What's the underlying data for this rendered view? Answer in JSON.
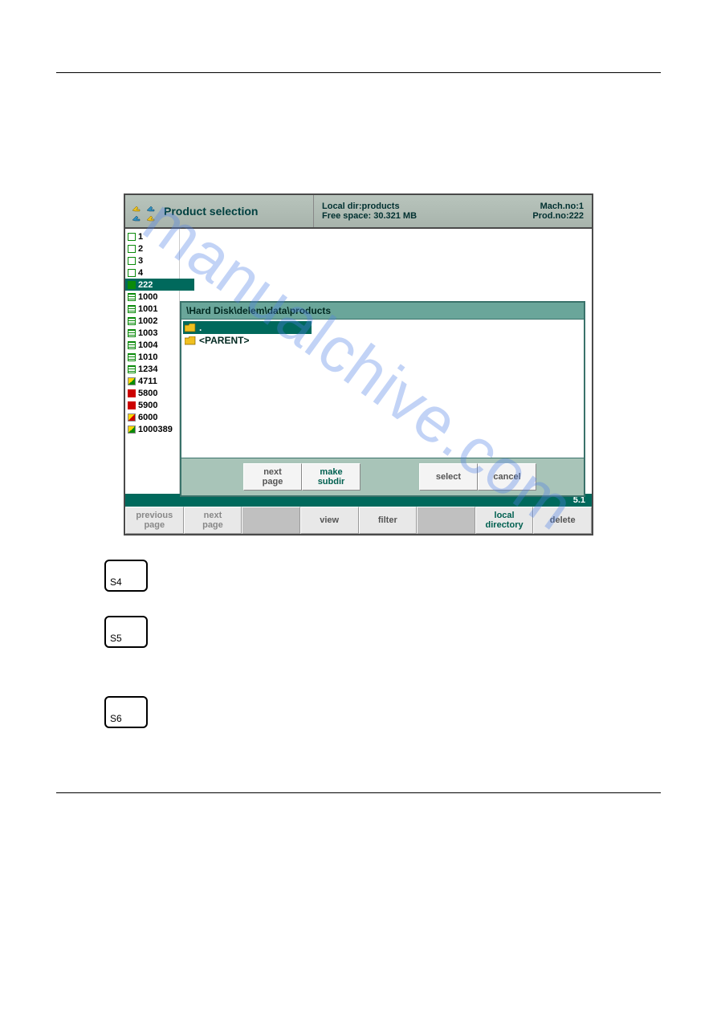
{
  "titlebar": {
    "title": "Product selection",
    "local_dir_label": "Local dir:",
    "local_dir_value": "products",
    "free_space_label": "Free space: ",
    "free_space_value": "30.321 MB",
    "mach_label": "Mach.no:",
    "mach_value": "1",
    "prod_label": "Prod.no:",
    "prod_value": "222"
  },
  "sidebar": {
    "items": [
      {
        "icon": "sq-green-open",
        "label": "1"
      },
      {
        "icon": "sq-green-open",
        "label": "2"
      },
      {
        "icon": "sq-green-open",
        "label": "3"
      },
      {
        "icon": "sq-green-open",
        "label": "4"
      },
      {
        "icon": "sq-green-fill",
        "label": "222",
        "selected": true
      },
      {
        "icon": "sq-lines",
        "label": "1000"
      },
      {
        "icon": "sq-lines",
        "label": "1001"
      },
      {
        "icon": "sq-lines",
        "label": "1002"
      },
      {
        "icon": "sq-lines",
        "label": "1003"
      },
      {
        "icon": "sq-lines",
        "label": "1004"
      },
      {
        "icon": "sq-lines",
        "label": "1010"
      },
      {
        "icon": "sq-lines",
        "label": "1234"
      },
      {
        "icon": "sq-box-yg",
        "label": "4711"
      },
      {
        "icon": "sq-red",
        "label": "5800"
      },
      {
        "icon": "sq-red",
        "label": "5900"
      },
      {
        "icon": "sq-red-box",
        "label": "6000"
      },
      {
        "icon": "sq-box-yg",
        "label": "1000389"
      }
    ]
  },
  "dialog": {
    "path": "\\Hard Disk\\delem\\data\\products",
    "items": [
      {
        "label": ".",
        "selected": true
      },
      {
        "label": "<PARENT>"
      }
    ],
    "buttons": {
      "b1": "",
      "b2": "next\npage",
      "b3": "make\nsubdir",
      "b4": "",
      "b5": "select",
      "b6": "cancel"
    }
  },
  "status": {
    "value": "5.1"
  },
  "bottom": {
    "b1": "previous\npage",
    "b2": "next\npage",
    "b3": "",
    "b4": "view",
    "b5": "filter",
    "b6": "",
    "b7": "local\ndirectory",
    "b8": "delete"
  },
  "keys": {
    "k1": "S4",
    "k2": "S5",
    "k3": "S6"
  },
  "watermark": "manualchive.com"
}
